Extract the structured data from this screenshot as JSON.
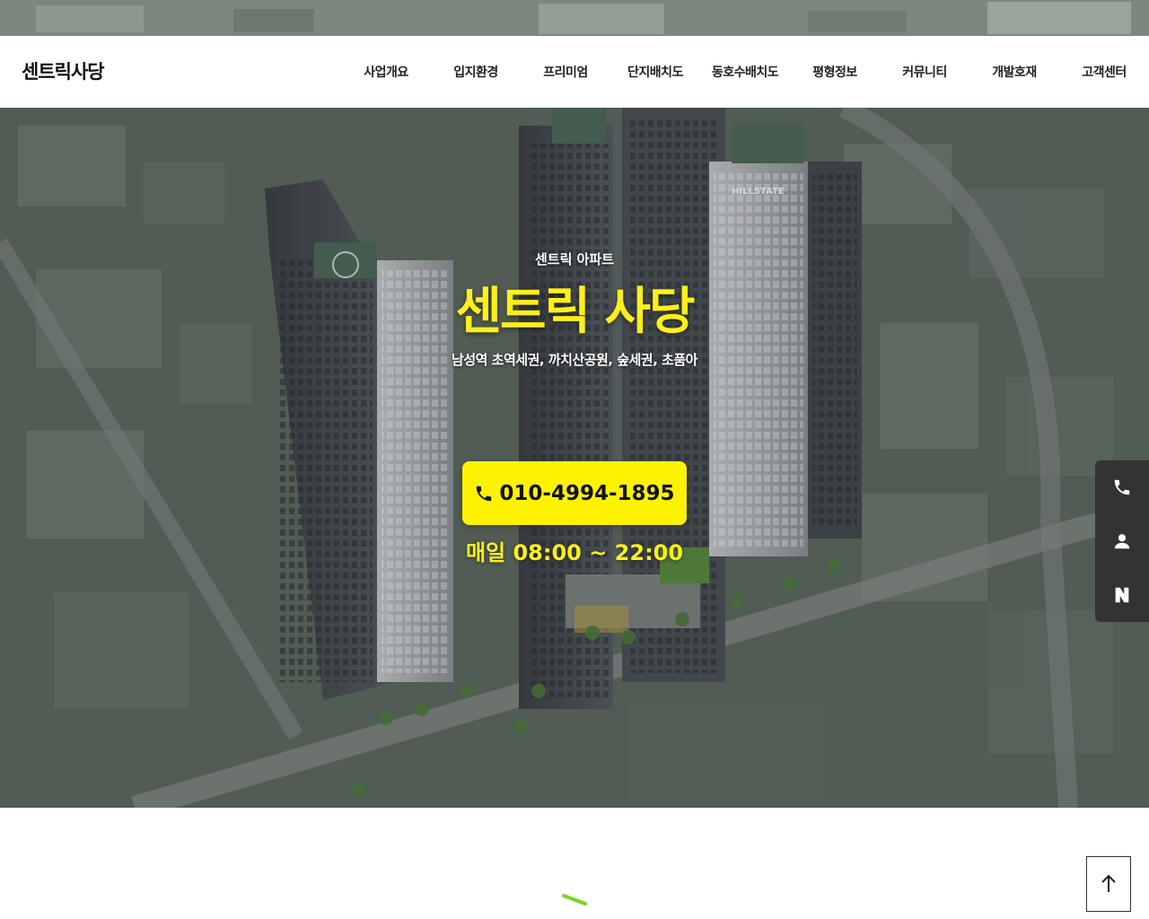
{
  "brand": {
    "logo": "센트릭사당"
  },
  "nav": {
    "items": [
      {
        "label": "사업개요"
      },
      {
        "label": "입지환경"
      },
      {
        "label": "프리미엄"
      },
      {
        "label": "단지배치도"
      },
      {
        "label": "동호수배치도"
      },
      {
        "label": "평형정보"
      },
      {
        "label": "커뮤니티"
      },
      {
        "label": "개발호재"
      },
      {
        "label": "고객센터"
      }
    ]
  },
  "hero": {
    "subtitle": "센트릭 아파트",
    "title": "센트릭 사당",
    "description": "남성역 초역세권, 까치산공원, 숲세권, 초품아",
    "building_sign": "HILLSTATE",
    "phone": "010-4994-1895",
    "hours": "매일 08:00 ~ 22:00"
  },
  "side_bar": {
    "items": [
      {
        "icon": "phone-icon"
      },
      {
        "icon": "user-icon"
      },
      {
        "icon": "naver-icon",
        "label": "N"
      }
    ]
  },
  "scroll_top": {
    "icon": "arrow-up-icon"
  },
  "colors": {
    "accent": "#fff200",
    "title_yellow": "#ffef1a",
    "side_bar": "#333333",
    "loader_green": "#7ed321"
  }
}
